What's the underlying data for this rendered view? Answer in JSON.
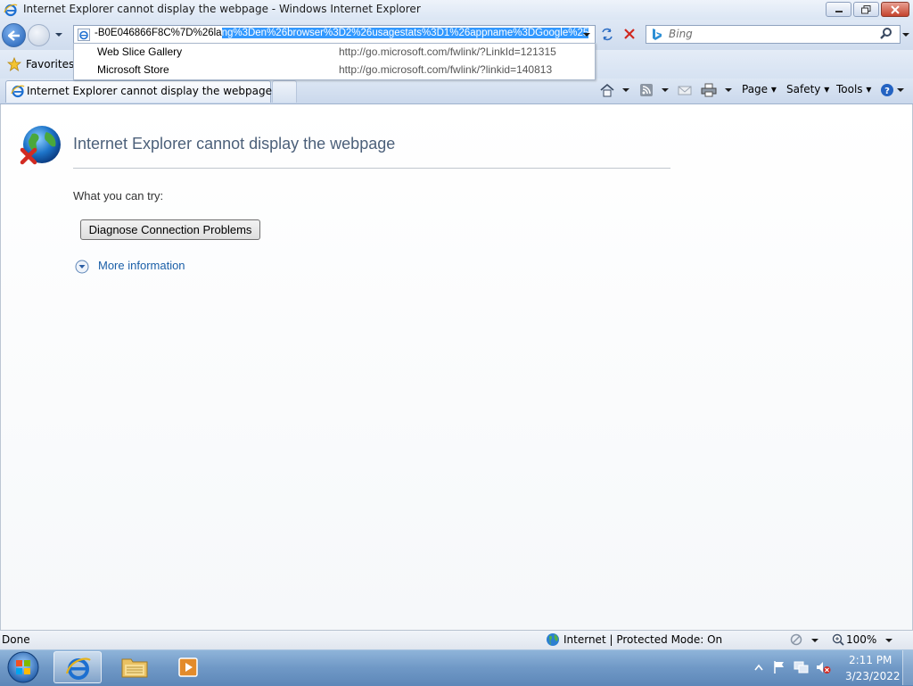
{
  "window": {
    "title": "Internet Explorer cannot display the webpage - Windows Internet Explorer"
  },
  "address": {
    "text_unselected": "-B0E046866F8C%7D%26la",
    "text_selected": "ng%3Den%26browser%3D2%26usagestats%3D1%26appname%3DGoogle%25"
  },
  "search": {
    "placeholder": "Bing"
  },
  "autocomplete": [
    {
      "name": "Web Slice Gallery",
      "url": "http://go.microsoft.com/fwlink/?LinkId=121315"
    },
    {
      "name": "Microsoft Store",
      "url": "http://go.microsoft.com/fwlink/?linkid=140813"
    }
  ],
  "favorites": {
    "label": "Favorites"
  },
  "tab": {
    "label": "Internet Explorer cannot display the webpage"
  },
  "commandbar": {
    "page": "Page",
    "safety": "Safety",
    "tools": "Tools"
  },
  "content": {
    "title": "Internet Explorer cannot display the webpage",
    "try_label": "What you can try:",
    "diagnose_button": "Diagnose Connection Problems",
    "more_info": "More information"
  },
  "status": {
    "text": "Done",
    "zone": "Internet | Protected Mode: On",
    "zoom": "100%"
  },
  "taskbar": {
    "time": "2:11 PM",
    "date": "3/23/2022"
  },
  "colors": {
    "selection": "#3399ff",
    "link": "#1a5fa8",
    "title_text": "#4c607a"
  }
}
